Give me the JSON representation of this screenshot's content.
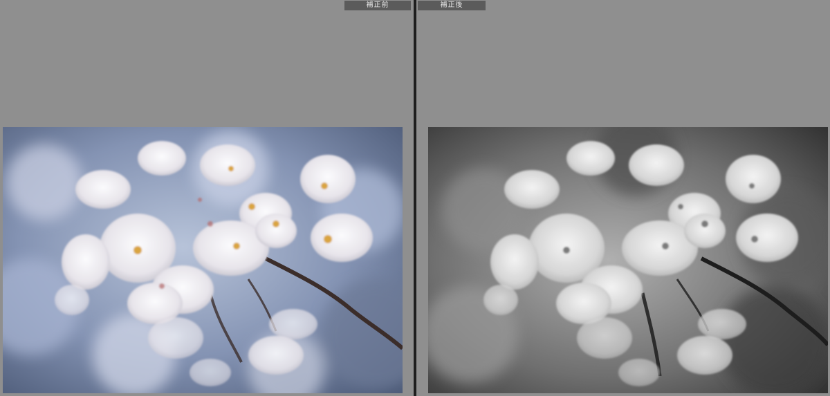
{
  "compare": {
    "before_label": "補正前",
    "after_label": "補正後"
  },
  "colors": {
    "background": "#8f8f8f",
    "divider": "#1e1e1e",
    "label_bg": "#5b5b5b",
    "label_text": "#e4e4e4",
    "before_sky": "#7f91b2",
    "after_bg": "#4a4a4a"
  },
  "icons": {
    "photo_subject": "cherry-blossom-photo"
  }
}
